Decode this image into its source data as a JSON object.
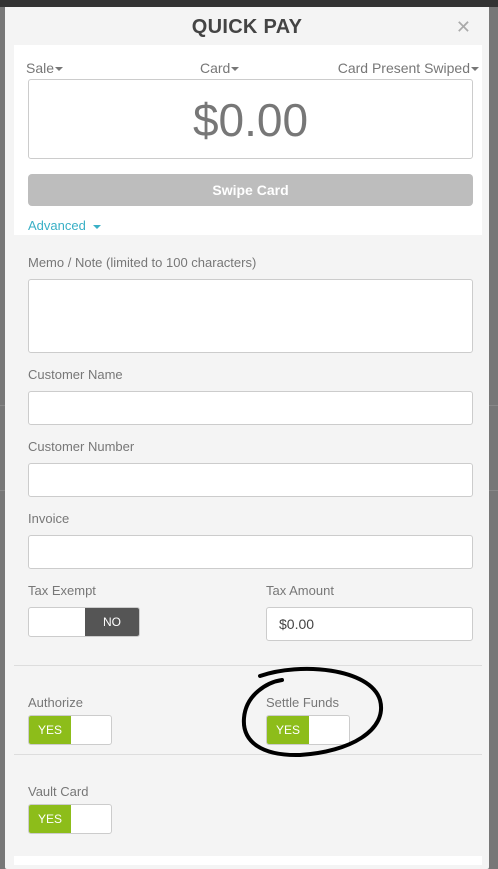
{
  "modal": {
    "title": "QUICK PAY",
    "close_icon": "close-icon"
  },
  "dropdowns": {
    "transaction_type": "Sale",
    "payment_method": "Card",
    "entry_mode": "Card Present Swiped"
  },
  "amount": {
    "value": "$0.00"
  },
  "swipe_button": {
    "label": "Swipe Card"
  },
  "advanced": {
    "label": "Advanced"
  },
  "form": {
    "memo_label": "Memo / Note (limited to 100 characters)",
    "memo_value": "",
    "customer_name_label": "Customer Name",
    "customer_name_value": "",
    "customer_number_label": "Customer Number",
    "customer_number_value": "",
    "invoice_label": "Invoice",
    "invoice_value": "",
    "tax_exempt_label": "Tax Exempt",
    "tax_exempt_state": "NO",
    "tax_amount_label": "Tax Amount",
    "tax_amount_value": "$0.00"
  },
  "options": {
    "authorize_label": "Authorize",
    "authorize_state": "YES",
    "settle_funds_label": "Settle Funds",
    "settle_funds_state": "YES",
    "vault_card_label": "Vault Card",
    "vault_card_state": "YES"
  },
  "colors": {
    "toggle_on": "#8dbd1a",
    "toggle_off": "#555555",
    "link": "#3ab0c6",
    "swipe_button": "#bdbdbd"
  }
}
